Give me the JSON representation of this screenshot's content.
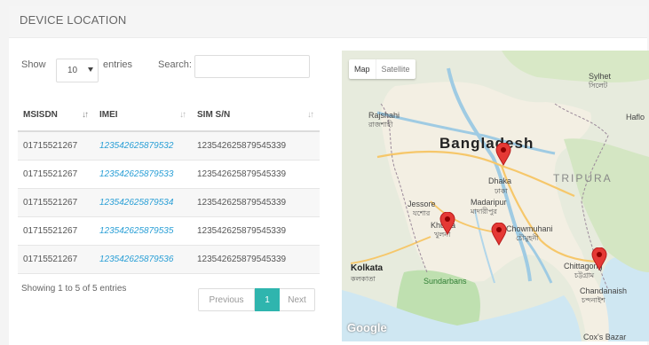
{
  "header": {
    "title": "DEVICE LOCATION"
  },
  "controls": {
    "show_label": "Show",
    "page_length": "10",
    "entries_label": "entries",
    "search_label": "Search:",
    "search_value": ""
  },
  "table": {
    "columns": [
      "MSISDN",
      "IMEI",
      "SIM S/N"
    ],
    "rows": [
      [
        "01715521267",
        "123542625879532",
        "123542625879545339"
      ],
      [
        "01715521267",
        "123542625879533",
        "123542625879545339"
      ],
      [
        "01715521267",
        "123542625879534",
        "123542625879545339"
      ],
      [
        "01715521267",
        "123542625879535",
        "123542625879545339"
      ],
      [
        "01715521267",
        "123542625879536",
        "123542625879545339"
      ]
    ]
  },
  "footer": {
    "info": "Showing 1 to 5 of 5 entries",
    "previous": "Previous",
    "current_page": "1",
    "next": "Next"
  },
  "map": {
    "type_map": "Map",
    "type_satellite": "Satellite",
    "google": "Google",
    "labels": {
      "country": "Bangladesh",
      "tripura": "TRIPURA",
      "rajshahi": "Rajshahi",
      "rajshahi_bn": "রাজশাহী",
      "dhaka": "Dhaka",
      "dhaka_bn": "ঢাকা",
      "jessore": "Jessore",
      "jessore_bn": "যশোর",
      "madaripur": "Madaripur",
      "madaripur_bn": "মাদারীপুর",
      "khulna": "Khulna",
      "khulna_bn": "খুলনা",
      "chowmuhani": "Chowmuhani",
      "chowmuhani_bn": "চৌমুহনী",
      "kolkata": "Kolkata",
      "kolkata_bn": "কলকাতা",
      "sundarbans": "Sundarbans",
      "chittagong": "Chittagong",
      "chittagong_bn": "চট্টগ্রাম",
      "chandanaish": "Chandanaish",
      "chandanaish_bn": "চন্দনাইশ",
      "sylhet": "Sylhet",
      "sylhet_bn": "সিলেট",
      "haflong": "Haflo",
      "coxs_bazar": "Cox's Bazar"
    }
  }
}
